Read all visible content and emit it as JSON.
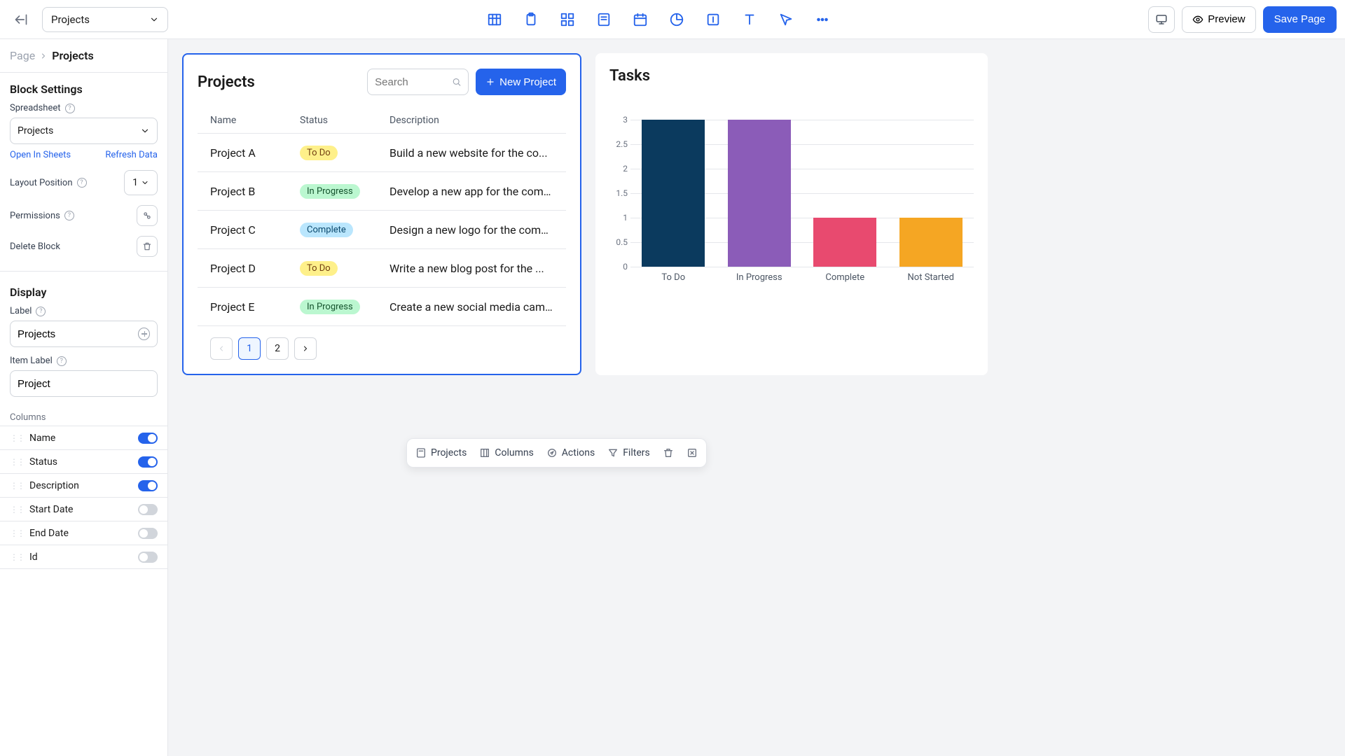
{
  "topbar": {
    "project_select": "Projects",
    "preview": "Preview",
    "save": "Save Page"
  },
  "breadcrumb": {
    "root": "Page",
    "current": "Projects"
  },
  "sidebar": {
    "block_settings_title": "Block Settings",
    "spreadsheet_label": "Spreadsheet",
    "spreadsheet_value": "Projects",
    "open_in_sheets": "Open In Sheets",
    "refresh_data": "Refresh Data",
    "layout_position_label": "Layout Position",
    "layout_position_value": "1",
    "permissions_label": "Permissions",
    "delete_block_label": "Delete Block",
    "display_title": "Display",
    "label_label": "Label",
    "label_value": "Projects",
    "item_label_label": "Item Label",
    "item_label_value": "Project",
    "columns_label": "Columns",
    "columns": [
      {
        "name": "Name",
        "on": true
      },
      {
        "name": "Status",
        "on": true
      },
      {
        "name": "Description",
        "on": true
      },
      {
        "name": "Start Date",
        "on": false
      },
      {
        "name": "End Date",
        "on": false
      },
      {
        "name": "Id",
        "on": false
      }
    ]
  },
  "projects_card": {
    "title": "Projects",
    "search_placeholder": "Search",
    "new_button": "New Project",
    "headers": {
      "name": "Name",
      "status": "Status",
      "description": "Description"
    },
    "rows": [
      {
        "name": "Project A",
        "status": "To Do",
        "status_class": "todo",
        "description": "Build a new website for the co..."
      },
      {
        "name": "Project B",
        "status": "In Progress",
        "status_class": "progress",
        "description": "Develop a new app for the comp..."
      },
      {
        "name": "Project C",
        "status": "Complete",
        "status_class": "complete",
        "description": "Design a new logo for the comp..."
      },
      {
        "name": "Project D",
        "status": "To Do",
        "status_class": "todo",
        "description": "Write a new blog post for the ..."
      },
      {
        "name": "Project E",
        "status": "In Progress",
        "status_class": "progress",
        "description": "Create a new social media camp..."
      }
    ],
    "pages": [
      "1",
      "2"
    ]
  },
  "tasks_card": {
    "title": "Tasks"
  },
  "chart_data": {
    "type": "bar",
    "categories": [
      "To Do",
      "In Progress",
      "Complete",
      "Not Started"
    ],
    "values": [
      3,
      3,
      1,
      1
    ],
    "colors": [
      "#0b3a5e",
      "#8b5cb8",
      "#e84a6f",
      "#f5a623"
    ],
    "ylim": [
      0,
      3
    ],
    "yticks": [
      0,
      0.5,
      1.0,
      1.5,
      2.0,
      2.5,
      3.0
    ]
  },
  "floating_toolbar": {
    "projects": "Projects",
    "columns": "Columns",
    "actions": "Actions",
    "filters": "Filters"
  }
}
